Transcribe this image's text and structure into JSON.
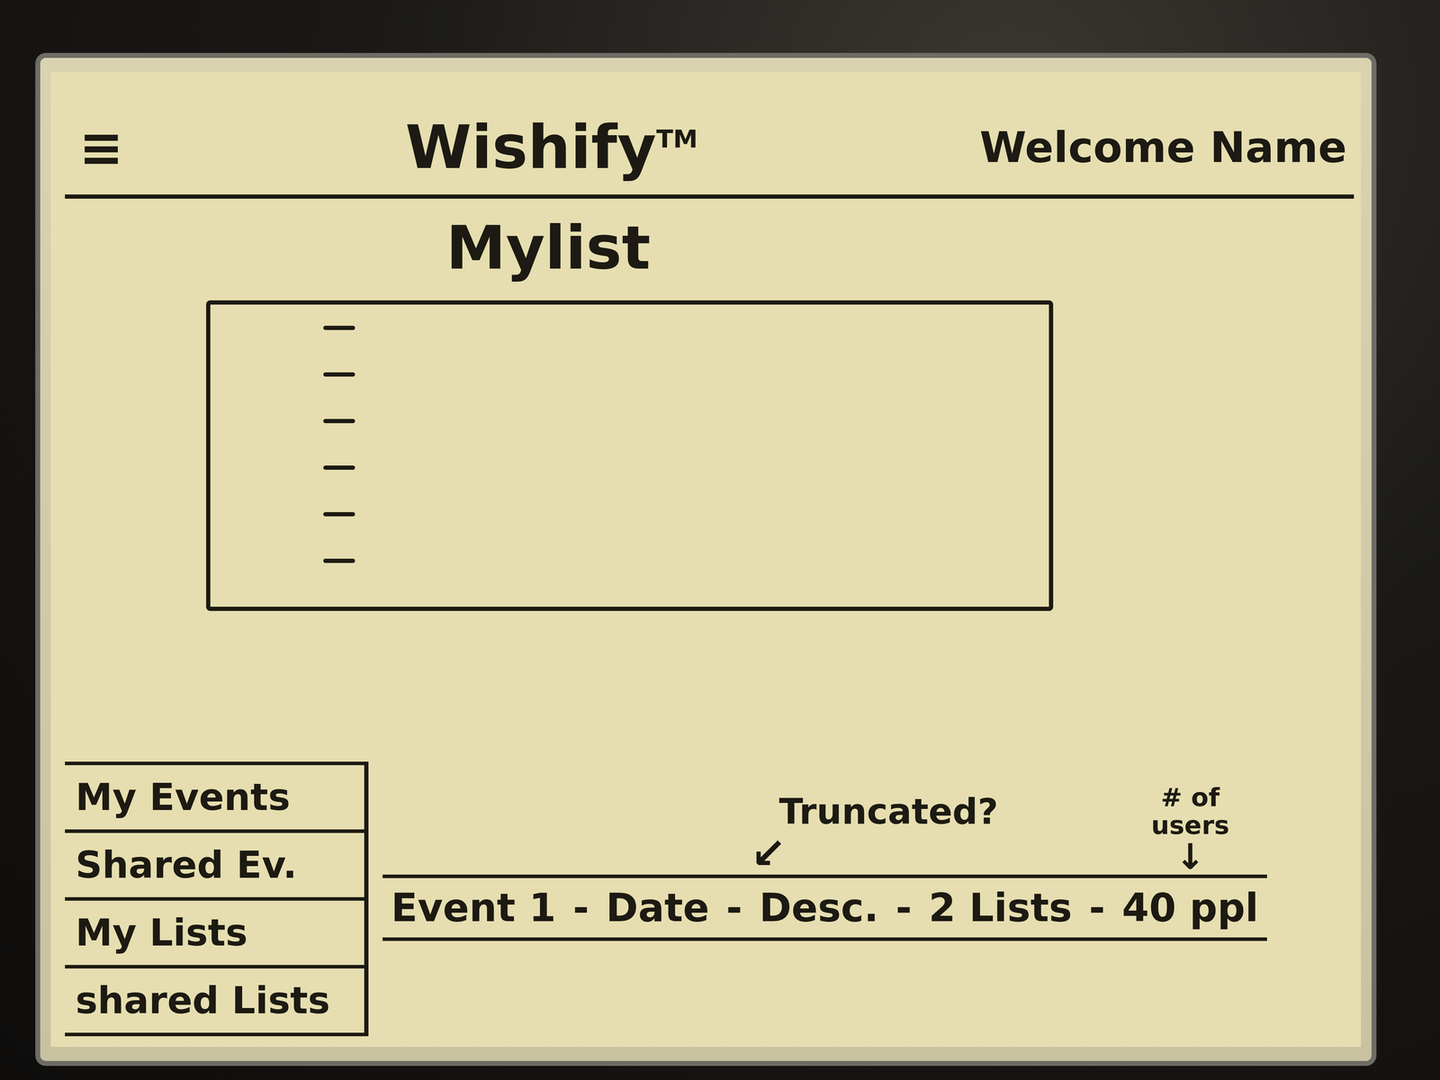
{
  "header": {
    "menu": "≡",
    "title": "Wishify",
    "mark": "TM",
    "welcome": "Welcome Name"
  },
  "my_list": {
    "heading": "Mylist",
    "placeholder_rows": 6
  },
  "sidebar": {
    "items": [
      {
        "label": "My Events"
      },
      {
        "label": "Shared Ev."
      },
      {
        "label": "My Lists"
      },
      {
        "label": "shared Lists"
      }
    ]
  },
  "event_row": {
    "separator": "-",
    "cells": [
      {
        "text": "Event 1"
      },
      {
        "text": "Date"
      },
      {
        "text": "Desc.",
        "note": {
          "kind": "diagonal",
          "text": "Truncated?",
          "arrow": "↙"
        }
      },
      {
        "text": "2 Lists"
      },
      {
        "text": "40 ppl",
        "note": {
          "kind": "stacked",
          "text": "# of users",
          "arrow": "↓"
        }
      }
    ]
  }
}
